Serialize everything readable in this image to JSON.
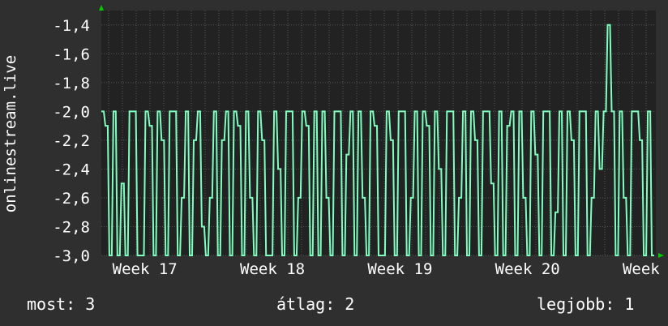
{
  "chart_data": {
    "type": "line",
    "ylabel": "onlinestream.live",
    "ylim": [
      -3.0,
      -1.3
    ],
    "yticks": [
      "-1,4",
      "-1,6",
      "-1,8",
      "-2,0",
      "-2,2",
      "-2,4",
      "-2,6",
      "-2,8",
      "-3,0"
    ],
    "ytick_values": [
      -1.4,
      -1.6,
      -1.8,
      -2.0,
      -2.2,
      -2.4,
      -2.6,
      -2.8,
      -3.0
    ],
    "xticks": [
      "Week 17",
      "Week 18",
      "Week 19",
      "Week 20",
      "Week"
    ],
    "xtick_positions": [
      0.02,
      0.25,
      0.48,
      0.71,
      0.94
    ],
    "grid": true,
    "colors": {
      "line": "#7fffbf",
      "background": "#222222",
      "grid": "#555555",
      "axis_arrow": "#00cc00"
    },
    "series": [
      {
        "values": [
          -2.0,
          -2.1,
          -3.0,
          -2.0,
          -3.0,
          -2.5,
          -3.0,
          -2.0,
          -2.0,
          -3.0,
          -3.0,
          -2.0,
          -2.1,
          -3.0,
          -2.0,
          -2.2,
          -3.0,
          -2.0,
          -2.0,
          -3.0,
          -2.6,
          -2.0,
          -3.0,
          -2.2,
          -2.0,
          -2.8,
          -3.0,
          -2.6,
          -2.0,
          -3.0,
          -2.2,
          -2.0,
          -3.0,
          -2.0,
          -2.1,
          -3.0,
          -2.0,
          -2.6,
          -3.0,
          -2.0,
          -2.2,
          -3.0,
          -3.0,
          -2.0,
          -2.4,
          -3.0,
          -2.0,
          -2.0,
          -3.0,
          -2.6,
          -2.0,
          -2.1,
          -3.0,
          -2.0,
          -3.0,
          -2.0,
          -2.6,
          -3.0,
          -2.0,
          -2.0,
          -3.0,
          -2.3,
          -2.0,
          -3.0,
          -2.0,
          -2.6,
          -3.0,
          -2.0,
          -2.1,
          -3.0,
          -3.0,
          -2.0,
          -2.2,
          -3.0,
          -2.0,
          -2.0,
          -3.0,
          -2.6,
          -2.0,
          -3.0,
          -2.0,
          -2.1,
          -3.0,
          -2.0,
          -2.4,
          -3.0,
          -2.0,
          -2.0,
          -3.0,
          -2.6,
          -2.0,
          -3.0,
          -2.0,
          -2.2,
          -3.0,
          -2.0,
          -2.0,
          -2.5,
          -3.0,
          -2.0,
          -3.0,
          -2.1,
          -2.0,
          -3.0,
          -2.0,
          -2.6,
          -3.0,
          -2.0,
          -2.3,
          -3.0,
          -2.0,
          -2.0,
          -3.0,
          -2.7,
          -2.0,
          -3.0,
          -2.0,
          -2.2,
          -3.0,
          -2.0,
          -2.0,
          -3.0,
          -2.6,
          -2.0,
          -2.4,
          -2.0,
          -1.4,
          -2.0,
          -3.0,
          -2.0,
          -2.6,
          -3.0,
          -2.0,
          -2.0,
          -2.2,
          -3.0,
          -2.0,
          -3.0
        ]
      }
    ]
  },
  "legend": {
    "current": "most: 3",
    "average": "átlag: 2",
    "best": "legjobb: 1"
  }
}
